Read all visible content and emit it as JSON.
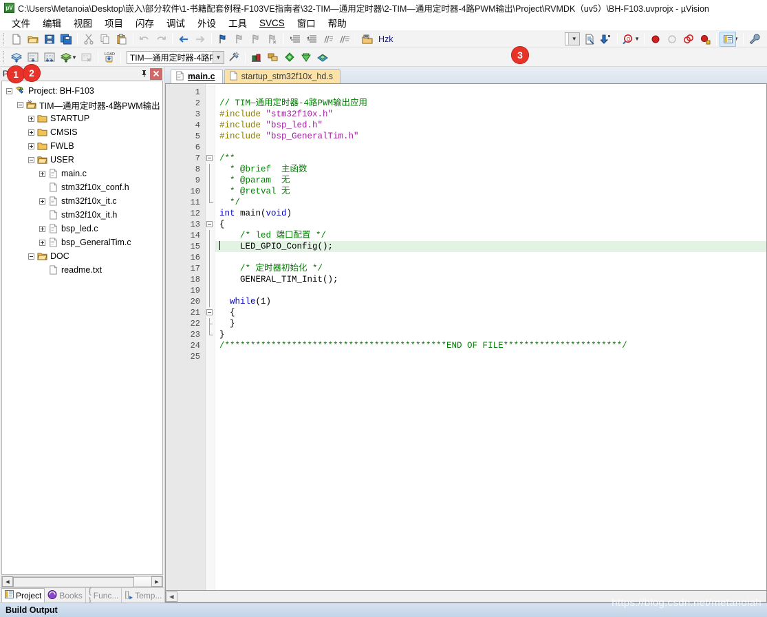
{
  "window": {
    "title": "C:\\Users\\Metanoia\\Desktop\\嵌入\\部分软件\\1-书籍配套例程-F103VE指南者\\32-TIM—通用定时器\\2-TIM—通用定时器-4路PWM输出\\Project\\RVMDK（uv5）\\BH-F103.uvprojx - µVision",
    "logo_text": "μV"
  },
  "menubar": {
    "items": [
      {
        "label": "文件"
      },
      {
        "label": "编辑"
      },
      {
        "label": "视图"
      },
      {
        "label": "项目"
      },
      {
        "label": "闪存"
      },
      {
        "label": "调试"
      },
      {
        "label": "外设"
      },
      {
        "label": "工具"
      },
      {
        "label": "SVCS",
        "underline_first": true
      },
      {
        "label": "窗口"
      },
      {
        "label": "帮助"
      }
    ]
  },
  "toolbar_main": {
    "buttons": [
      {
        "name": "new-file-icon",
        "tip": "New"
      },
      {
        "name": "open-file-icon",
        "tip": "Open"
      },
      {
        "name": "save-icon",
        "tip": "Save"
      },
      {
        "name": "save-all-icon",
        "tip": "Save All"
      },
      {
        "name": "cut-icon",
        "tip": "Cut"
      },
      {
        "name": "copy-icon",
        "tip": "Copy"
      },
      {
        "name": "paste-icon",
        "tip": "Paste"
      },
      {
        "name": "undo-icon",
        "tip": "Undo"
      },
      {
        "name": "redo-icon",
        "tip": "Redo"
      },
      {
        "name": "navigate-back-icon",
        "tip": "Back"
      },
      {
        "name": "navigate-forward-icon",
        "tip": "Forward"
      },
      {
        "name": "bookmark-toggle-icon",
        "tip": "Toggle Bookmark"
      },
      {
        "name": "bookmark-prev-icon",
        "tip": "Previous Bookmark"
      },
      {
        "name": "bookmark-next-icon",
        "tip": "Next Bookmark"
      },
      {
        "name": "bookmark-clear-icon",
        "tip": "Clear Bookmarks"
      },
      {
        "name": "indent-increase-icon",
        "tip": "Indent"
      },
      {
        "name": "indent-decrease-icon",
        "tip": "Outdent"
      },
      {
        "name": "comment-icon",
        "tip": "Comment"
      },
      {
        "name": "uncomment-icon",
        "tip": "Uncomment"
      },
      {
        "name": "hzk-icon",
        "tip": "Configure"
      }
    ],
    "hzk_label": "Hzk",
    "right_buttons": [
      {
        "name": "file-properties-icon"
      },
      {
        "name": "goto-definition-icon"
      },
      {
        "name": "find-in-files-icon"
      },
      {
        "name": "breakpoint-insert-icon"
      },
      {
        "name": "breakpoint-disable-icon"
      },
      {
        "name": "breakpoint-kill-all-icon"
      },
      {
        "name": "breakpoint-disable-all-icon"
      },
      {
        "name": "project-window-icon"
      },
      {
        "name": "configure-wizard-icon"
      }
    ]
  },
  "toolbar_build": {
    "buttons": [
      {
        "name": "translate-icon"
      },
      {
        "name": "build-icon"
      },
      {
        "name": "rebuild-icon"
      },
      {
        "name": "batch-build-icon"
      },
      {
        "name": "stop-build-icon"
      },
      {
        "name": "download-to-flash-icon"
      }
    ],
    "target_select": {
      "value": "TIM—通用定时器-4路P",
      "name": "target-select"
    },
    "after_buttons": [
      {
        "name": "target-options-icon"
      },
      {
        "name": "manage-run-environment-icon"
      },
      {
        "name": "multi-project-icon"
      },
      {
        "name": "pack-installer-icon"
      },
      {
        "name": "manage-components-icon"
      },
      {
        "name": "configuration-wizard-icon"
      }
    ]
  },
  "badges": [
    {
      "id": "badge1",
      "text": "1"
    },
    {
      "id": "badge2",
      "text": "2"
    },
    {
      "id": "badge3",
      "text": "3"
    }
  ],
  "project_panel": {
    "title": "Project",
    "pin_icon": "pin-icon",
    "close_icon": "close-icon",
    "tree": [
      {
        "label": "Project: BH-F103",
        "depth": 0,
        "toggle": "minus",
        "icon": "project-icon"
      },
      {
        "label": "TIM—通用定时器-4路PWM输出",
        "depth": 1,
        "toggle": "minus",
        "icon": "target-icon"
      },
      {
        "label": "STARTUP",
        "depth": 2,
        "toggle": "plus",
        "icon": "folder-closed-icon"
      },
      {
        "label": "CMSIS",
        "depth": 2,
        "toggle": "plus",
        "icon": "folder-closed-icon"
      },
      {
        "label": "FWLB",
        "depth": 2,
        "toggle": "plus",
        "icon": "folder-closed-icon"
      },
      {
        "label": "USER",
        "depth": 2,
        "toggle": "minus",
        "icon": "folder-open-icon"
      },
      {
        "label": "main.c",
        "depth": 3,
        "toggle": "plus",
        "icon": "c-file-icon"
      },
      {
        "label": "stm32f10x_conf.h",
        "depth": 3,
        "toggle": "none",
        "icon": "h-file-icon"
      },
      {
        "label": "stm32f10x_it.c",
        "depth": 3,
        "toggle": "plus",
        "icon": "c-file-icon"
      },
      {
        "label": "stm32f10x_it.h",
        "depth": 3,
        "toggle": "none",
        "icon": "h-file-icon"
      },
      {
        "label": "bsp_led.c",
        "depth": 3,
        "toggle": "plus",
        "icon": "c-file-icon"
      },
      {
        "label": "bsp_GeneralTim.c",
        "depth": 3,
        "toggle": "plus",
        "icon": "c-file-icon"
      },
      {
        "label": "DOC",
        "depth": 2,
        "toggle": "minus",
        "icon": "folder-open-icon"
      },
      {
        "label": "readme.txt",
        "depth": 3,
        "toggle": "none",
        "icon": "txt-file-icon"
      }
    ],
    "bottom_tabs": [
      {
        "label": "Project",
        "icon": "project-tab-icon",
        "active": true
      },
      {
        "label": "Books",
        "icon": "books-tab-icon",
        "active": false
      },
      {
        "label": "Func...",
        "icon": "functions-tab-icon",
        "active": false
      },
      {
        "label": "Temp...",
        "icon": "templates-tab-icon",
        "active": false
      }
    ]
  },
  "editor": {
    "tabs": [
      {
        "label": "main.c",
        "active": true,
        "icon": "c-file-icon"
      },
      {
        "label": "startup_stm32f10x_hd.s",
        "active": false,
        "icon": "asm-file-icon"
      }
    ],
    "current_line": 15,
    "line_count": 25,
    "lines": [
      {
        "n": 1,
        "fold": "none",
        "tokens": []
      },
      {
        "n": 2,
        "fold": "none",
        "tokens": [
          {
            "t": "// TIM—通用定时器-4路PWM输出应用",
            "c": "comment"
          }
        ]
      },
      {
        "n": 3,
        "fold": "none",
        "tokens": [
          {
            "t": "#include ",
            "c": "pre"
          },
          {
            "t": "\"stm32f10x.h\"",
            "c": "str"
          }
        ]
      },
      {
        "n": 4,
        "fold": "none",
        "tokens": [
          {
            "t": "#include ",
            "c": "pre"
          },
          {
            "t": "\"bsp_led.h\"",
            "c": "str"
          }
        ]
      },
      {
        "n": 5,
        "fold": "none",
        "tokens": [
          {
            "t": "#include ",
            "c": "pre"
          },
          {
            "t": "\"bsp_GeneralTim.h\"",
            "c": "str"
          }
        ]
      },
      {
        "n": 6,
        "fold": "none",
        "tokens": []
      },
      {
        "n": 7,
        "fold": "start",
        "tokens": [
          {
            "t": "/**",
            "c": "comment"
          }
        ]
      },
      {
        "n": 8,
        "fold": "bar",
        "tokens": [
          {
            "t": "  * @brief  主函数",
            "c": "comment"
          }
        ]
      },
      {
        "n": 9,
        "fold": "bar",
        "tokens": [
          {
            "t": "  * @param  无",
            "c": "comment"
          }
        ]
      },
      {
        "n": 10,
        "fold": "bar",
        "tokens": [
          {
            "t": "  * @retval 无",
            "c": "comment"
          }
        ]
      },
      {
        "n": 11,
        "fold": "end",
        "tokens": [
          {
            "t": "  */",
            "c": "comment"
          }
        ]
      },
      {
        "n": 12,
        "fold": "none",
        "tokens": [
          {
            "t": "int ",
            "c": "kw"
          },
          {
            "t": "main(",
            "c": "plain"
          },
          {
            "t": "void",
            "c": "kw"
          },
          {
            "t": ")",
            "c": "plain"
          }
        ]
      },
      {
        "n": 13,
        "fold": "start",
        "tokens": [
          {
            "t": "{",
            "c": "plain"
          }
        ]
      },
      {
        "n": 14,
        "fold": "bar",
        "tokens": [
          {
            "t": "    /* led 端口配置 */",
            "c": "comment"
          }
        ]
      },
      {
        "n": 15,
        "fold": "bar",
        "tokens": [
          {
            "t": "    LED_GPIO_Config();",
            "c": "plain"
          }
        ]
      },
      {
        "n": 16,
        "fold": "bar",
        "tokens": []
      },
      {
        "n": 17,
        "fold": "bar",
        "tokens": [
          {
            "t": "    /* 定时器初始化 */",
            "c": "comment"
          }
        ]
      },
      {
        "n": 18,
        "fold": "bar",
        "tokens": [
          {
            "t": "    GENERAL_TIM_Init();",
            "c": "plain"
          }
        ]
      },
      {
        "n": 19,
        "fold": "bar",
        "tokens": []
      },
      {
        "n": 20,
        "fold": "bar",
        "tokens": [
          {
            "t": "  while",
            "c": "kw"
          },
          {
            "t": "(1)",
            "c": "plain"
          }
        ]
      },
      {
        "n": 21,
        "fold": "start2",
        "tokens": [
          {
            "t": "  {",
            "c": "plain"
          }
        ]
      },
      {
        "n": 22,
        "fold": "tick",
        "tokens": [
          {
            "t": "  }",
            "c": "plain"
          }
        ]
      },
      {
        "n": 23,
        "fold": "end",
        "tokens": [
          {
            "t": "}",
            "c": "plain"
          }
        ]
      },
      {
        "n": 24,
        "fold": "none",
        "tokens": [
          {
            "t": "/*******************************************END OF FILE***********************/",
            "c": "comment"
          }
        ]
      },
      {
        "n": 25,
        "fold": "none",
        "tokens": []
      }
    ]
  },
  "status": {
    "build_output_label": "Build Output"
  },
  "watermark": {
    "text": "https://blog.csdn.net/metanoiah"
  },
  "colors": {
    "comment": "#008000",
    "preprocessor": "#8a7a00",
    "string": "#a020a0",
    "keyword": "#0000c0",
    "current_line_bg": "#e3f3e3",
    "badge_red": "#e8332a",
    "tab_inactive_bg": "#fde2a5"
  }
}
